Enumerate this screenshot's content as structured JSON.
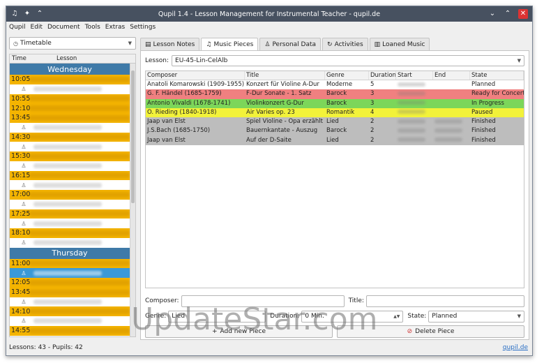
{
  "window": {
    "title": "Qupil 1.4 - Lesson Management for Instrumental Teacher - qupil.de"
  },
  "menu": [
    "Qupil",
    "Edit",
    "Document",
    "Tools",
    "Extras",
    "Settings"
  ],
  "left": {
    "view_select": "Timetable",
    "header_time": "Time",
    "header_lesson": "Lesson",
    "rows": [
      {
        "type": "day",
        "text": "Wednesday"
      },
      {
        "type": "time",
        "text": "10:05"
      },
      {
        "type": "pupil"
      },
      {
        "type": "time",
        "text": "10:55"
      },
      {
        "type": "time",
        "text": "12:10"
      },
      {
        "type": "time",
        "text": "13:45"
      },
      {
        "type": "pupil"
      },
      {
        "type": "time",
        "text": "14:30"
      },
      {
        "type": "pupil"
      },
      {
        "type": "time",
        "text": "15:30"
      },
      {
        "type": "pupil"
      },
      {
        "type": "time",
        "text": "16:15"
      },
      {
        "type": "pupil"
      },
      {
        "type": "time",
        "text": "17:00"
      },
      {
        "type": "pupil"
      },
      {
        "type": "time",
        "text": "17:25"
      },
      {
        "type": "pupil"
      },
      {
        "type": "time",
        "text": "18:10"
      },
      {
        "type": "pupil"
      },
      {
        "type": "day",
        "text": "Thursday"
      },
      {
        "type": "time",
        "text": "11:00"
      },
      {
        "type": "pupil-selected"
      },
      {
        "type": "time",
        "text": "12:05"
      },
      {
        "type": "time",
        "text": "13:45"
      },
      {
        "type": "pupil"
      },
      {
        "type": "time",
        "text": "14:10"
      },
      {
        "type": "pupil"
      },
      {
        "type": "time",
        "text": "14:55"
      }
    ]
  },
  "tabs": [
    {
      "label": "Lesson Notes",
      "icon": "note-icon"
    },
    {
      "label": "Music Pieces",
      "icon": "music-icon"
    },
    {
      "label": "Personal Data",
      "icon": "person-icon"
    },
    {
      "label": "Activities",
      "icon": "refresh-icon"
    },
    {
      "label": "Loaned Music",
      "icon": "book-icon"
    }
  ],
  "lesson": {
    "label": "Lesson:",
    "value": "EU-45-Lin-CelAlb"
  },
  "table": {
    "columns": [
      "Composer",
      "Title",
      "Genre",
      "Duration",
      "Start",
      "End",
      "State"
    ],
    "rows": [
      {
        "composer": "Anatoli Komarowski (1909-1955)",
        "title": "Konzert für Violine A-Dur",
        "genre": "Moderne",
        "duration": "5",
        "state": "Planned",
        "color": "#ffffff",
        "has_end": false
      },
      {
        "composer": "G. F. Händel (1685-1759)",
        "title": "F-Dur Sonate - 1. Satz",
        "genre": "Barock",
        "duration": "3",
        "state": "Ready for Concert",
        "color": "#f08080",
        "has_end": false
      },
      {
        "composer": "Antonio Vivaldi (1678-1741)",
        "title": "Violinkonzert G-Dur",
        "genre": "Barock",
        "duration": "3",
        "state": "In Progress",
        "color": "#7cd65a",
        "has_end": false
      },
      {
        "composer": "O. Rieding (1840-1918)",
        "title": "Air Varies op. 23",
        "genre": "Romantik",
        "duration": "4",
        "state": "Paused",
        "color": "#f2f23a",
        "has_end": false
      },
      {
        "composer": "Jaap van Elst",
        "title": "Spiel Violine - Opa erzählt",
        "genre": "Lied",
        "duration": "2",
        "state": "Finished",
        "color": "#bdbdbd",
        "has_end": true
      },
      {
        "composer": "J.S.Bach (1685-1750)",
        "title": "Bauernkantate - Auszug",
        "genre": "Barock",
        "duration": "2",
        "state": "Finished",
        "color": "#bdbdbd",
        "has_end": true
      },
      {
        "composer": "Jaap van Elst",
        "title": "Auf der D-Saite",
        "genre": "Lied",
        "duration": "2",
        "state": "Finished",
        "color": "#bdbdbd",
        "has_end": true
      }
    ]
  },
  "edit": {
    "composer_label": "Composer:",
    "title_label": "Title:",
    "genre_label": "Genre:",
    "genre_value": "Lied",
    "duration_label": "Duration:",
    "duration_value": "0 Min.",
    "state_label": "State:",
    "state_value": "Planned",
    "add_button": "Add new Piece",
    "delete_button": "Delete Piece"
  },
  "status": {
    "text": "Lessons: 43 - Pupils: 42",
    "link": "qupil.de"
  },
  "watermark": "UpdateStar.com"
}
